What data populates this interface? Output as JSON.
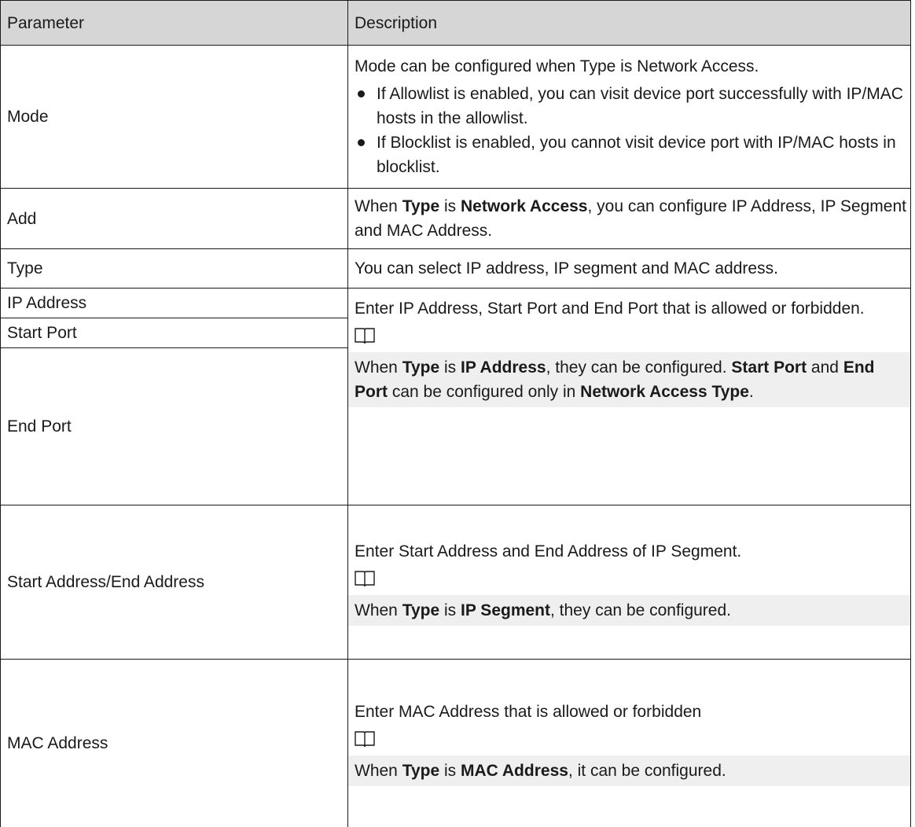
{
  "table": {
    "headers": {
      "parameter": "Parameter",
      "description": "Description"
    },
    "rows": {
      "mode": {
        "param": "Mode",
        "intro": "Mode can be configured when Type is Network Access.",
        "bullet_1": "If Allowlist is enabled, you can visit device port successfully with IP/MAC hosts in the allowlist.",
        "bullet_2": "If Blocklist is enabled, you cannot visit device port with IP/MAC hosts in blocklist."
      },
      "add": {
        "param": "Add",
        "t1": "When ",
        "b_type": "Type",
        "t2": "  is ",
        "b_value": "Network Access",
        "t3": ", you can configure IP Address, IP Segment and MAC Address."
      },
      "type": {
        "param": "Type",
        "desc": "You can select IP address, IP segment and MAC address."
      },
      "ip_group": {
        "param_ip": "IP Address",
        "param_start": "Start Port",
        "param_end": "End Port",
        "desc": "Enter IP Address, Start Port and End Port that is allowed or forbidden.",
        "n1": "When ",
        "n_type": "Type",
        "n2": "  is ",
        "n_ip": "IP Address",
        "n3": ", they can be configured. ",
        "n_start": "Start Port",
        "n4": " and ",
        "n_end": "End Port",
        "n5": " can be configured only in ",
        "n_access": "Network Access Type",
        "n6": "."
      },
      "segment": {
        "param": "Start Address/End Address",
        "desc": "Enter Start Address and End Address of IP Segment.",
        "n1": "When ",
        "n_type": "Type",
        "n2": "  is ",
        "n_val": "IP Segment",
        "n3": ", they can be configured."
      },
      "mac": {
        "param": "MAC Address",
        "desc": "Enter MAC Address that is allowed or forbidden",
        "n1": "When ",
        "n_type": "Type",
        "n2": "  is ",
        "n_val": "MAC Address",
        "n3": ", it can be configured."
      }
    }
  },
  "icons": {
    "note": "book-icon"
  }
}
